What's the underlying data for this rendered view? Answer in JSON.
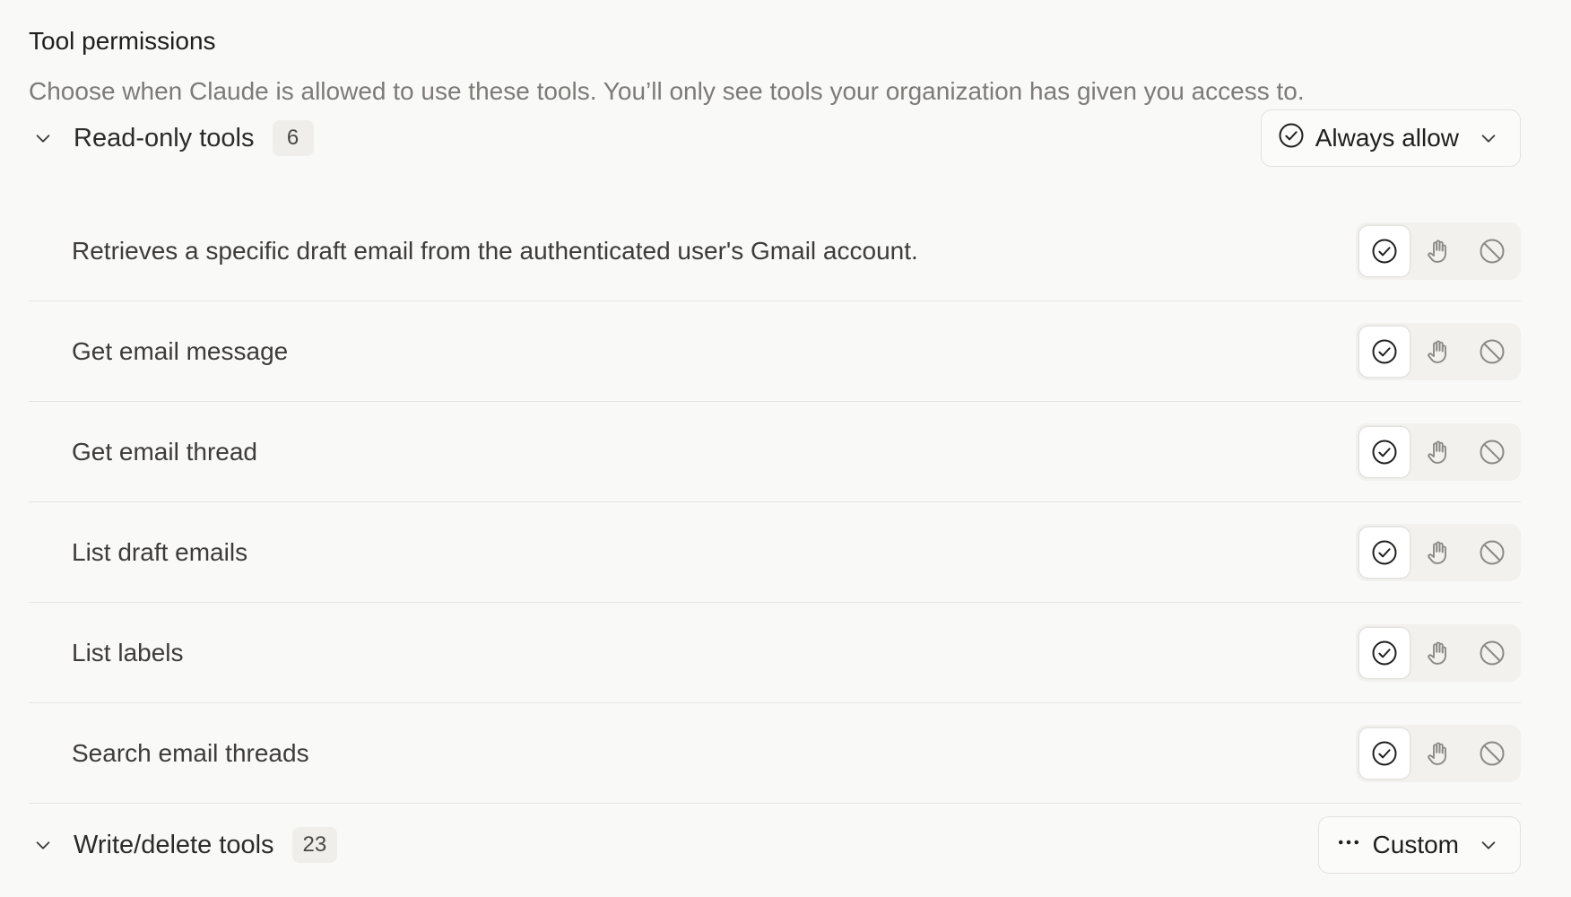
{
  "section": {
    "title": "Tool permissions",
    "subtitle": "Choose when Claude is allowed to use these tools. You’ll only see tools your organization has given you access to."
  },
  "groups": [
    {
      "title": "Read-only tools",
      "count": "6",
      "setting_label": "Always allow",
      "setting_icon": "check-circle-icon"
    },
    {
      "title": "Write/delete tools",
      "count": "23",
      "setting_label": "Custom",
      "setting_icon": "ellipsis-icon"
    }
  ],
  "read_only_tools": [
    {
      "label": "Retrieves a specific draft email from the authenticated user's Gmail account.",
      "selected": "allow"
    },
    {
      "label": "Get email message",
      "selected": "allow"
    },
    {
      "label": "Get email thread",
      "selected": "allow"
    },
    {
      "label": "List draft emails",
      "selected": "allow"
    },
    {
      "label": "List labels",
      "selected": "allow"
    },
    {
      "label": "Search email threads",
      "selected": "allow"
    }
  ],
  "permission_options": [
    {
      "value": "allow",
      "icon": "check-circle-icon"
    },
    {
      "value": "ask",
      "icon": "hand-icon"
    },
    {
      "value": "block",
      "icon": "block-icon"
    }
  ],
  "colors": {
    "background": "#f9f9f8",
    "text_primary": "#1f1f1e",
    "text_muted": "#7c7b77",
    "border": "#e6e5e1",
    "icon_inactive": "#8a8985"
  }
}
